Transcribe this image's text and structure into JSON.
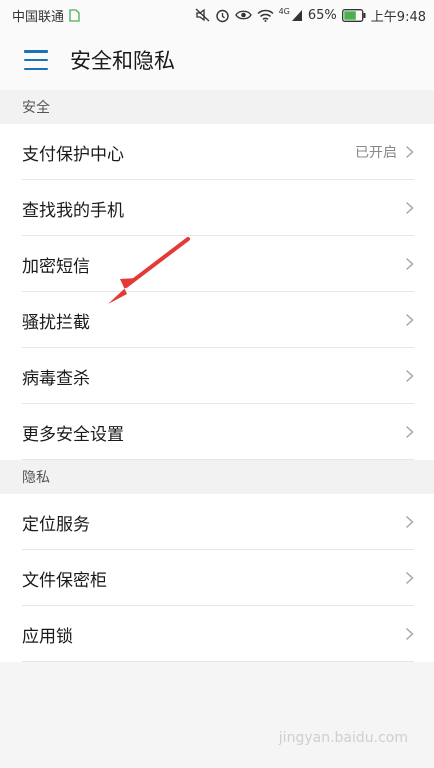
{
  "status_bar": {
    "carrier": "中国联通",
    "battery": "65%",
    "time": "上午9:48",
    "network": "4G",
    "icons": [
      "sim-icon",
      "mute-icon",
      "alarm-icon",
      "eye-icon",
      "wifi-icon",
      "signal-icon",
      "battery-icon"
    ]
  },
  "header": {
    "title": "安全和隐私",
    "menu_icon": "menu-icon",
    "accent_color": "#1a73b8"
  },
  "sections": [
    {
      "title": "安全",
      "items": [
        {
          "label": "支付保护中心",
          "status": "已开启"
        },
        {
          "label": "查找我的手机",
          "status": ""
        },
        {
          "label": "加密短信",
          "status": ""
        },
        {
          "label": "骚扰拦截",
          "status": ""
        },
        {
          "label": "病毒查杀",
          "status": ""
        },
        {
          "label": "更多安全设置",
          "status": ""
        }
      ]
    },
    {
      "title": "隐私",
      "items": [
        {
          "label": "定位服务",
          "status": ""
        },
        {
          "label": "文件保密柜",
          "status": ""
        },
        {
          "label": "应用锁",
          "status": ""
        }
      ]
    }
  ],
  "annotation": {
    "arrow_color": "#e53935"
  },
  "watermark": {
    "text": "jingyan.baidu.com"
  }
}
